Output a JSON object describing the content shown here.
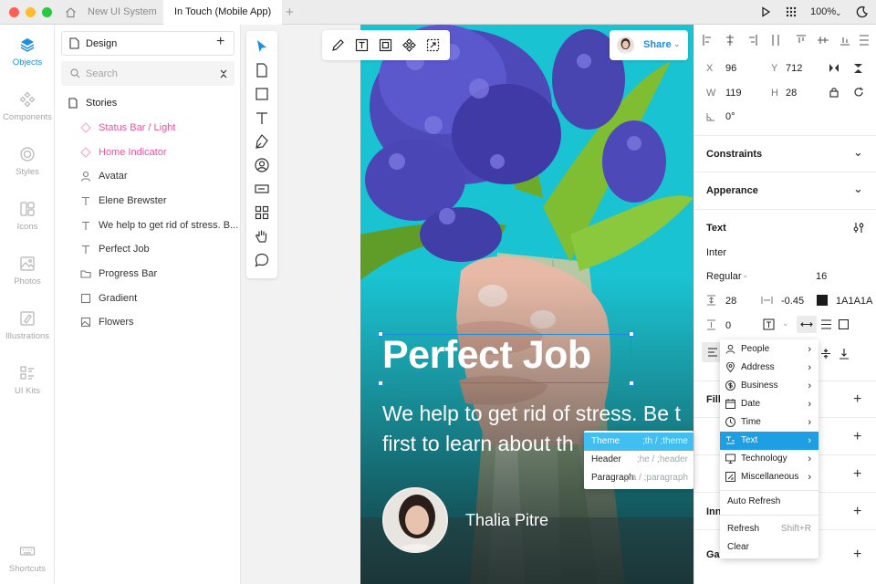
{
  "titlebar": {
    "tab_inactive": "New UI System",
    "tab_active": "In Touch (Mobile App)",
    "zoom": "100%"
  },
  "rail": {
    "items": [
      {
        "label": "Objects",
        "icon": "layers-icon"
      },
      {
        "label": "Components",
        "icon": "components-icon"
      },
      {
        "label": "Styles",
        "icon": "styles-icon"
      },
      {
        "label": "Icons",
        "icon": "icons-icon"
      },
      {
        "label": "Photos",
        "icon": "photos-icon"
      },
      {
        "label": "Illustrations",
        "icon": "illustrations-icon"
      },
      {
        "label": "UI Kits",
        "icon": "ui-kits-icon"
      },
      {
        "label": "Shortcuts",
        "icon": "keyboard-icon"
      }
    ]
  },
  "layers": {
    "page": "Design",
    "search_placeholder": "Search",
    "group": "Stories",
    "items": [
      {
        "label": "Status Bar / Light",
        "icon": "component-icon",
        "highlight": true
      },
      {
        "label": "Home Indicator",
        "icon": "component-icon",
        "highlight": true
      },
      {
        "label": "Avatar",
        "icon": "user-icon",
        "highlight": false
      },
      {
        "label": "Elene Brewster",
        "icon": "text-icon",
        "highlight": false
      },
      {
        "label": "We help to get rid of stress. B...",
        "icon": "text-icon",
        "highlight": false
      },
      {
        "label": "Perfect Job",
        "icon": "text-icon",
        "highlight": false
      },
      {
        "label": "Progress Bar",
        "icon": "folder-icon",
        "highlight": false
      },
      {
        "label": "Gradient",
        "icon": "rectangle-icon",
        "highlight": false
      },
      {
        "label": "Flowers",
        "icon": "image-icon",
        "highlight": false
      }
    ]
  },
  "canvas": {
    "share_label": "Share",
    "headline": "Perfect Job",
    "body_line1": "We help to get rid of stress. Be t",
    "body_line2": "first to learn about th",
    "author": "Thalia Pitre"
  },
  "props": {
    "x_label": "X",
    "x": "96",
    "y_label": "Y",
    "y": "712",
    "w_label": "W",
    "w": "119",
    "h_label": "H",
    "h": "28",
    "rotation": "0°",
    "constraints": "Constraints",
    "appearance": "Apperance",
    "text_title": "Text",
    "font": "Inter",
    "weight": "Regular",
    "size": "16",
    "line_height": "28",
    "letter_spacing": "-0.45",
    "color_hex": "1A1A1A",
    "color": "#1a1a1a",
    "paragraph": "0",
    "fill_partial": "Fill",
    "inner_partial": "Inn",
    "gauss_partial": "Gau"
  },
  "menu": {
    "items": [
      {
        "label": "People",
        "icon": "person-icon"
      },
      {
        "label": "Address",
        "icon": "pin-icon"
      },
      {
        "label": "Business",
        "icon": "dollar-icon"
      },
      {
        "label": "Date",
        "icon": "calendar-icon"
      },
      {
        "label": "Time",
        "icon": "clock-icon"
      },
      {
        "label": "Text",
        "icon": "text-lines-icon",
        "selected": true
      },
      {
        "label": "Technology",
        "icon": "monitor-icon"
      },
      {
        "label": "Miscellaneous",
        "icon": "misc-icon"
      }
    ],
    "auto_refresh": "Auto Refresh",
    "refresh": "Refresh",
    "refresh_shortcut": "Shift+R",
    "clear": "Clear"
  },
  "submenu": {
    "items": [
      {
        "label": "Theme",
        "shortcut": ";th / ;theme",
        "selected": true
      },
      {
        "label": "Header",
        "shortcut": ";he / ;header"
      },
      {
        "label": "Paragraph",
        "shortcut": ";pa / ;paragraph"
      }
    ]
  },
  "colors": {
    "accent": "#1b8ee0",
    "highlight_layer": "#e8569b",
    "menu_selected": "#1e9fe3",
    "submenu_selected": "#40bff0",
    "phone_bg": "#1cc4d2"
  }
}
